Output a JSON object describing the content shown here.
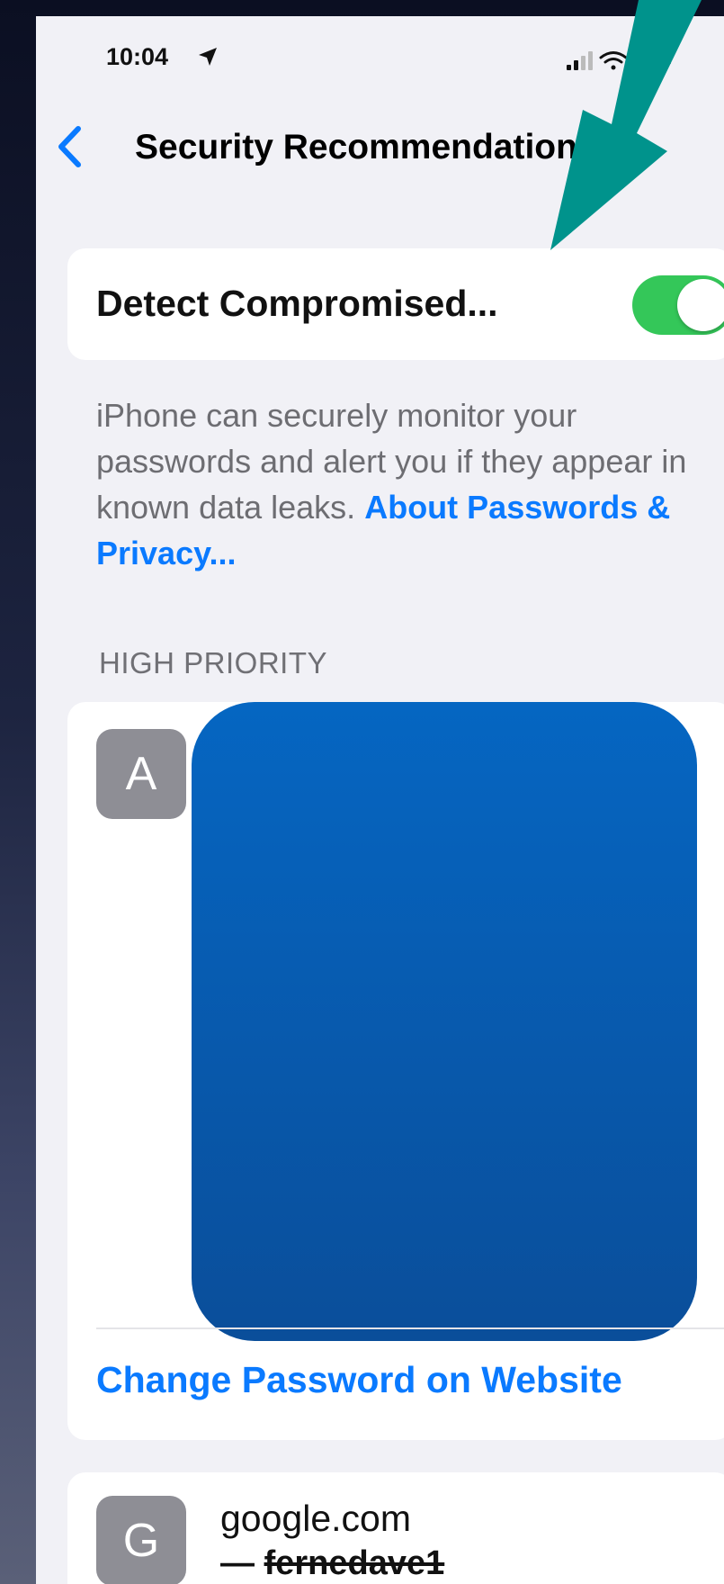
{
  "status_bar": {
    "time": "10:04",
    "location_icon": "location-arrow-icon",
    "signal_icon": "cellular-signal-icon",
    "wifi_icon": "wifi-icon",
    "battery_icon": "battery-icon"
  },
  "nav": {
    "back_icon": "chevron-left-icon",
    "title": "Security Recommendations"
  },
  "detect_setting": {
    "label": "Detect Compromised...",
    "enabled": true,
    "description": "iPhone can securely monitor your passwords and alert you if they appear in known data leaks.",
    "link_text": "About Passwords & Privacy..."
  },
  "high_priority": {
    "header": "HIGH PRIORITY",
    "items": [
      {
        "avatar_letter": "A",
        "action_label": "Change Password on Website"
      },
      {
        "avatar_letter": "G",
        "domain": "google.com",
        "username_prefix": "— ",
        "username": "fernedave1"
      }
    ]
  },
  "colors": {
    "accent": "#0a7aff",
    "toggle_on": "#34c759",
    "annotation_arrow": "#00938c",
    "redaction": "#0566c2"
  }
}
